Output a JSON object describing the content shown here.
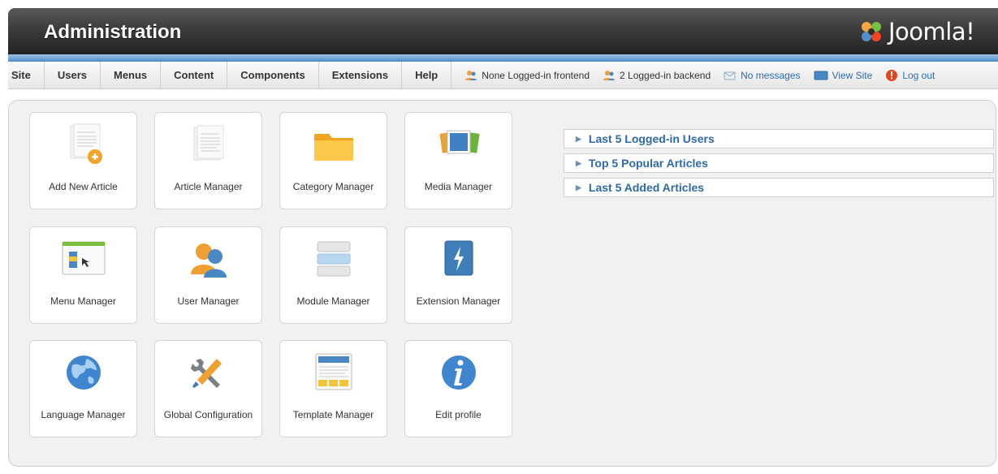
{
  "header": {
    "title": "Administration",
    "logo_text": "Joomla!"
  },
  "menu": {
    "items": [
      "Site",
      "Users",
      "Menus",
      "Content",
      "Components",
      "Extensions",
      "Help"
    ]
  },
  "status": {
    "frontend": "None Logged-in frontend",
    "backend": "2 Logged-in backend",
    "messages": "No messages",
    "view_site": "View Site",
    "logout": "Log out"
  },
  "tiles": [
    {
      "label": "Add New Article",
      "icon": "add-article-icon"
    },
    {
      "label": "Article Manager",
      "icon": "article-icon"
    },
    {
      "label": "Category Manager",
      "icon": "folder-icon"
    },
    {
      "label": "Media Manager",
      "icon": "media-icon"
    },
    {
      "label": "Menu Manager",
      "icon": "menu-icon"
    },
    {
      "label": "User Manager",
      "icon": "users-icon"
    },
    {
      "label": "Module Manager",
      "icon": "module-icon"
    },
    {
      "label": "Extension Manager",
      "icon": "extension-icon"
    },
    {
      "label": "Language Manager",
      "icon": "globe-icon"
    },
    {
      "label": "Global Configuration",
      "icon": "tools-icon"
    },
    {
      "label": "Template Manager",
      "icon": "template-icon"
    },
    {
      "label": "Edit profile",
      "icon": "info-icon"
    }
  ],
  "panels": [
    "Last 5 Logged-in Users",
    "Top 5 Popular Articles",
    "Last 5 Added Articles"
  ],
  "colors": {
    "accent_blue": "#4e8cc9",
    "link": "#2a6db5",
    "panel_title": "#2f6aa8"
  }
}
